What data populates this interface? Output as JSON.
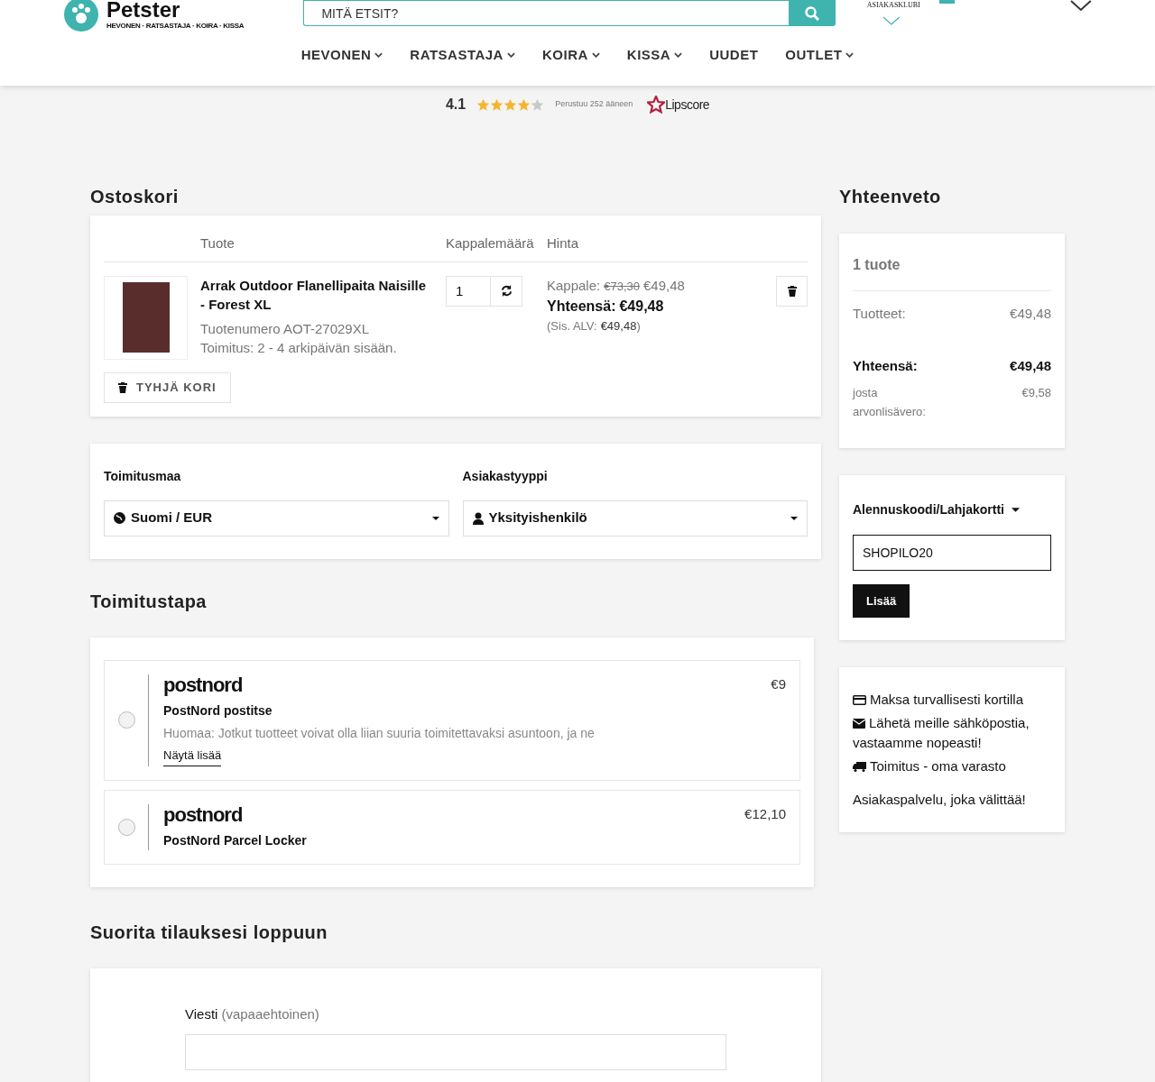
{
  "header": {
    "logo": {
      "name": "Petster",
      "tagline": "HEVONEN · RATSASTAJA · KOIRA · KISSA"
    },
    "search": {
      "placeholder": "MITÄ ETSIT?"
    },
    "club_label": "ASIAKASKLUBI",
    "nav": [
      {
        "label": "HEVONEN",
        "dropdown": true
      },
      {
        "label": "RATSASTAJA",
        "dropdown": true
      },
      {
        "label": "KOIRA",
        "dropdown": true
      },
      {
        "label": "KISSA",
        "dropdown": true
      },
      {
        "label": "UUDET",
        "dropdown": false
      },
      {
        "label": "OUTLET",
        "dropdown": true
      }
    ]
  },
  "rating": {
    "score": "4.1",
    "stars": 4.1,
    "caption": "Perustuu 252 ääneen",
    "brand": "Lipscore"
  },
  "cart": {
    "title": "Ostoskori",
    "columns": [
      "Tuote",
      "Kappalemäärä",
      "Hinta"
    ],
    "items": [
      {
        "name": "Arrak Outdoor Flanellipaita Naisille - Forest XL",
        "sku": "Tuotenumero AOT-27029XL",
        "delivery": "Toimitus: 2 - 4 arkipäivän sisään.",
        "quantity": "1",
        "unit_label": "Kappale:",
        "old_price": "€73,30",
        "price": "€49,48",
        "total_label": "Yhteensä:",
        "total": "€49,48",
        "vat_label": "(Sis. ALV:",
        "vat": "€49,48",
        "vat_close": ")"
      }
    ],
    "empty_button": "TYHJÄ KORI"
  },
  "selectors": [
    {
      "label": "Toimitusmaa",
      "value": "Suomi / EUR",
      "kind": "globe"
    },
    {
      "label": "Asiakastyyppi",
      "value": "Yksityishenkilö",
      "kind": "user"
    }
  ],
  "shipping": {
    "title": "Toimitustapa",
    "options": [
      {
        "brand": "postnord",
        "name": "PostNord postitse",
        "price": "€9",
        "note": "Huomaa: Jotkut tuotteet voivat olla liian suuria toimitettavaksi asuntoon, ja ne",
        "more_link": "Näytä lisää",
        "selected": false
      },
      {
        "brand": "postnord",
        "name": "PostNord Parcel Locker",
        "price": "€12,10",
        "selected": false
      }
    ]
  },
  "complete": {
    "title": "Suorita tilauksesi loppuun",
    "message_label": "Viesti",
    "message_hint": "(vapaaehtoinen)"
  },
  "summary": {
    "title": "Yhteenveto",
    "count": "1 tuote",
    "rows": [
      {
        "label": "Tuotteet:",
        "value": "€49,48",
        "kind": "normal"
      },
      {
        "label": "Yhteensä:",
        "value": "€49,48",
        "kind": "total"
      },
      {
        "label": "josta arvonlisävero:",
        "value": "€9,58",
        "kind": "small"
      }
    ]
  },
  "coupon": {
    "label": "Alennuskoodi/Lahjakortti",
    "value": "SHOPILO20",
    "button": "Lisää"
  },
  "info": {
    "items": [
      {
        "kind": "card",
        "text": "Maksa turvallisesti kortilla"
      },
      {
        "kind": "mail",
        "text": "Lähetä meille sähköpostia, vastaamme nopeasti!"
      },
      {
        "kind": "truck",
        "text": "Toimitus - oma varasto"
      }
    ],
    "footer": "Asiakaspalvelu, joka välittää!"
  }
}
